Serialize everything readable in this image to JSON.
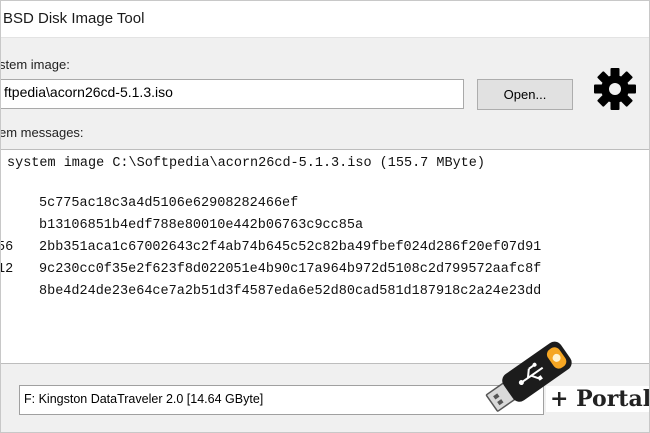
{
  "window": {
    "title": "BSD Disk Image Tool"
  },
  "form": {
    "system_image_label": "stem image:",
    "system_image_value": "ftpedia\\acorn26cd-5.1.3.iso",
    "open_button": "Open...",
    "messages_label": "em messages:"
  },
  "messages": {
    "header": "system image C:\\Softpedia\\acorn26cd-5.1.3.iso (155.7 MByte)",
    "hashes": [
      {
        "label": "",
        "value": "5c775ac18c3a4d5106e62908282466ef"
      },
      {
        "label": "",
        "value": "b13106851b4edf788e80010e442b06763c9cc85a"
      },
      {
        "label": "56",
        "value": "2bb351aca1c67002643c2f4ab74b645c52c82ba49fbef024d286f20ef07d91"
      },
      {
        "label": "12",
        "value": "9c230cc0f35e2f623f8d022051e4b90c17a964b972d5108c2d799572aafc8f"
      },
      {
        "label": "",
        "value": "8be4d24de23e64ce7a2b51d3f4587eda6e52d80cad581d187918c2a24e23dd"
      }
    ]
  },
  "drive": {
    "selected": "F: Kingston DataTraveler 2.0 [14.64 GByte]"
  },
  "badge": {
    "text": "+ Portal"
  },
  "icons": {
    "settings": "gear-icon",
    "usb": "usb-drive-icon"
  },
  "colors": {
    "window_bg": "#f0f0f0",
    "button_bg": "#e1e1e1",
    "accent": "#f5a623"
  }
}
